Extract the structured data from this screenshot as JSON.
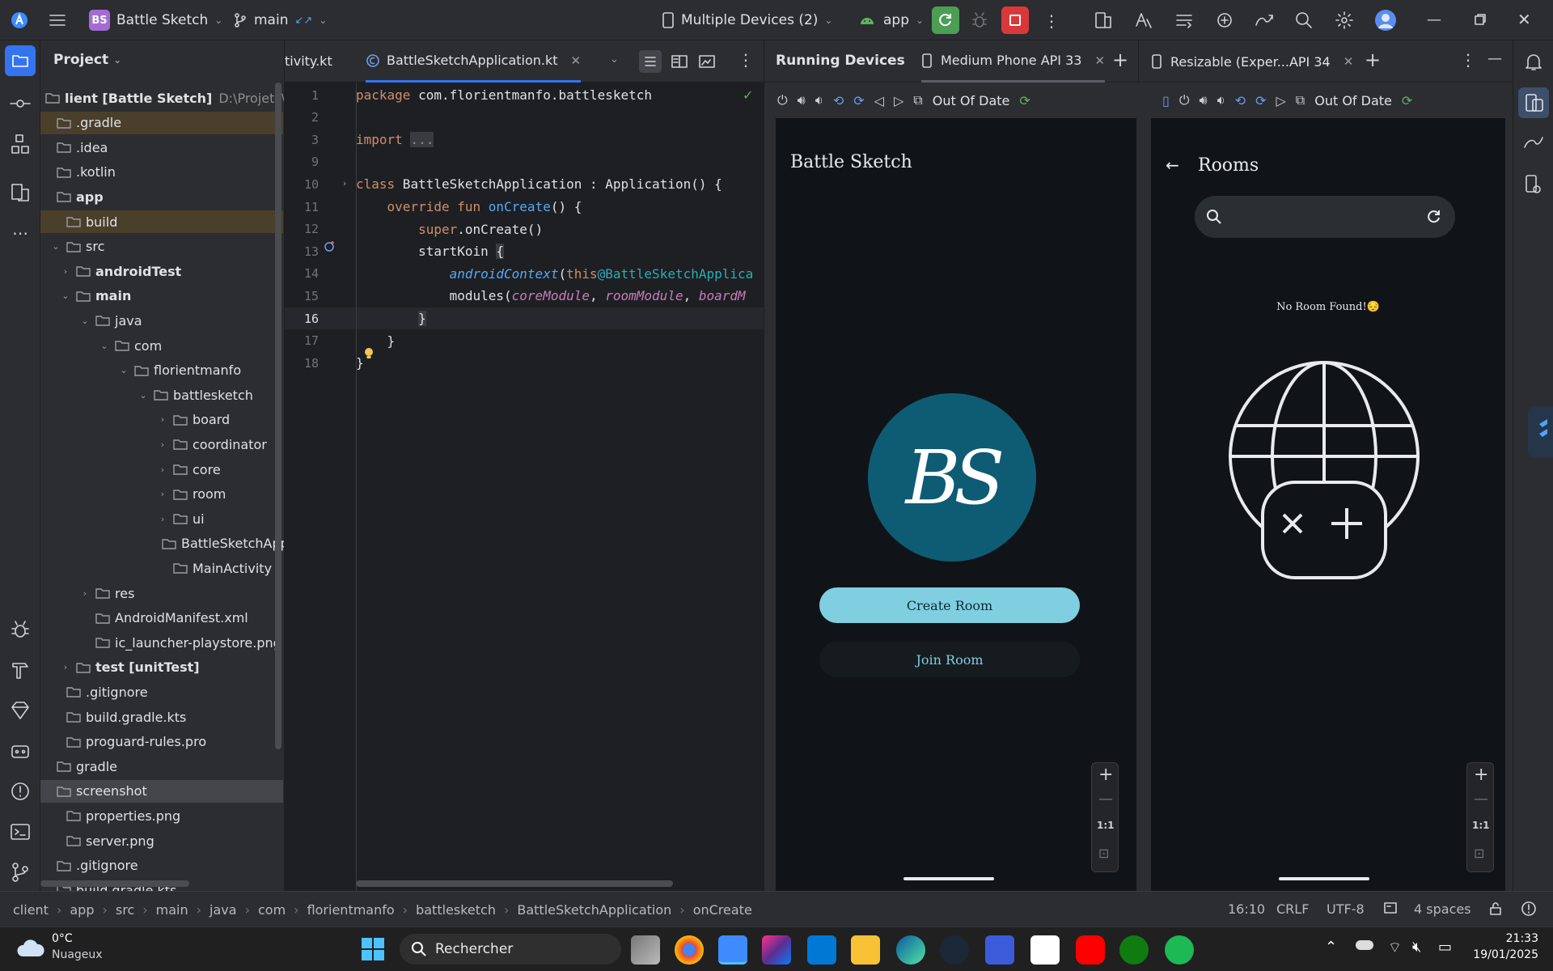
{
  "titlebar": {
    "project_badge": "BS",
    "project_name": "Battle Sketch",
    "branch": "main",
    "devices": "Multiple Devices (2)",
    "run_config": "app"
  },
  "project_panel": {
    "title": "Project",
    "tree": [
      {
        "label": "lient [Battle Sketch]",
        "extra": "D:\\Projets\\Andro",
        "indent": 0,
        "chev": "",
        "bold": true,
        "hl": false,
        "sel": false
      },
      {
        "label": ".gradle",
        "indent": 0,
        "chev": "",
        "hl": true,
        "sel": false
      },
      {
        "label": ".idea",
        "indent": 0,
        "chev": ""
      },
      {
        "label": ".kotlin",
        "indent": 0,
        "chev": ""
      },
      {
        "label": "app",
        "indent": 0,
        "chev": "",
        "bold": true
      },
      {
        "label": "build",
        "indent": 0.5,
        "chev": "",
        "hl": true
      },
      {
        "label": "src",
        "indent": 0.5,
        "chev": "v"
      },
      {
        "label": "androidTest",
        "indent": 1,
        "chev": ">",
        "bold": true
      },
      {
        "label": "main",
        "indent": 1,
        "chev": "v",
        "bold": true
      },
      {
        "label": "java",
        "indent": 2,
        "chev": "v"
      },
      {
        "label": "com",
        "indent": 3,
        "chev": "v"
      },
      {
        "label": "florientmanfo",
        "indent": 4,
        "chev": "v"
      },
      {
        "label": "battlesketch",
        "indent": 5,
        "chev": "v"
      },
      {
        "label": "board",
        "indent": 6,
        "chev": ">"
      },
      {
        "label": "coordinator",
        "indent": 6,
        "chev": ">"
      },
      {
        "label": "core",
        "indent": 6,
        "chev": ">"
      },
      {
        "label": "room",
        "indent": 6,
        "chev": ">"
      },
      {
        "label": "ui",
        "indent": 6,
        "chev": ">"
      },
      {
        "label": "BattleSketchApp",
        "indent": 6,
        "chev": ""
      },
      {
        "label": "MainActivity",
        "indent": 6,
        "chev": ""
      },
      {
        "label": "res",
        "indent": 2,
        "chev": ">"
      },
      {
        "label": "AndroidManifest.xml",
        "indent": 2,
        "chev": ""
      },
      {
        "label": "ic_launcher-playstore.png",
        "indent": 2,
        "chev": ""
      },
      {
        "label": "test [unitTest]",
        "indent": 1,
        "chev": ">",
        "bold": true
      },
      {
        "label": ".gitignore",
        "indent": 0.5,
        "chev": ""
      },
      {
        "label": "build.gradle.kts",
        "indent": 0.5,
        "chev": ""
      },
      {
        "label": "proguard-rules.pro",
        "indent": 0.5,
        "chev": ""
      },
      {
        "label": "gradle",
        "indent": 0,
        "chev": ""
      },
      {
        "label": "screenshot",
        "indent": 0,
        "chev": "",
        "sel": true
      },
      {
        "label": "properties.png",
        "indent": 0.5,
        "chev": ""
      },
      {
        "label": "server.png",
        "indent": 0.5,
        "chev": ""
      },
      {
        "label": ".gitignore",
        "indent": 0,
        "chev": ""
      },
      {
        "label": "build.gradle.kts",
        "indent": 0,
        "chev": ""
      }
    ]
  },
  "editor": {
    "tab_prev": "tivity.kt",
    "tab_active": "BattleSketchApplication.kt",
    "lines": [
      {
        "n": "1",
        "html": "<span class='kw'>package</span> com.florientmanfo.battlesketch"
      },
      {
        "n": "2",
        "html": ""
      },
      {
        "n": "3",
        "html": "<span class='kw'>import</span> <span class='gr' style='background:#393b40'>...</span>"
      },
      {
        "n": "9",
        "html": ""
      },
      {
        "n": "10",
        "html": "<span class='kw'>class</span> BattleSketchApplication : Application() {"
      },
      {
        "n": "11",
        "html": "    <span class='kw'>override fun</span> <span class='fn'>onCreate</span>() {"
      },
      {
        "n": "12",
        "html": "        <span class='kw'>super</span>.onCreate()"
      },
      {
        "n": "13",
        "html": "        startKoin <span style='background:#393b40'>{</span>"
      },
      {
        "n": "14",
        "html": "            <span class='fn' style='font-style:italic'>androidContext</span>(<span class='kw'>this</span><span class='an'>@BattleSketchApplica</span>"
      },
      {
        "n": "15",
        "html": "            modules(<span class='it'>coreModule</span>, <span class='it'>roomModule</span>, <span class='it'>boardM</span>"
      },
      {
        "n": "16",
        "html": "        <span style='background:#393b40'>}</span>"
      },
      {
        "n": "17",
        "html": "    }"
      },
      {
        "n": "18",
        "html": "}"
      }
    ]
  },
  "devices": {
    "title": "Running Devices",
    "tab1": "Medium Phone API 33",
    "tab2": "Resizable (Exper...API 34",
    "out_of_date": "Out Of Date",
    "out_of_date2": "Out Of Date",
    "phone1": {
      "app_title": "Battle Sketch",
      "logo_text": "BS",
      "create_label": "Create Room",
      "join_label": "Join Room"
    },
    "phone2": {
      "title": "Rooms",
      "empty": "No Room Found!😔"
    },
    "zoom_11": "1:1",
    "zoom_11b": "1:1"
  },
  "statusbar": {
    "crumbs": [
      "client",
      "app",
      "src",
      "main",
      "java",
      "com",
      "florientmanfo",
      "battlesketch",
      "BattleSketchApplication",
      "onCreate"
    ],
    "position": "16:10",
    "line_sep": "CRLF",
    "encoding": "UTF-8",
    "indent": "4 spaces"
  },
  "taskbar": {
    "temp": "0°C",
    "weather": "Nuageux",
    "search": "Rechercher",
    "time": "21:33",
    "date": "19/01/2025"
  },
  "colors": {
    "accent": "#3574f0",
    "teal": "#0e5c73",
    "button_light": "#7fcfe0"
  }
}
